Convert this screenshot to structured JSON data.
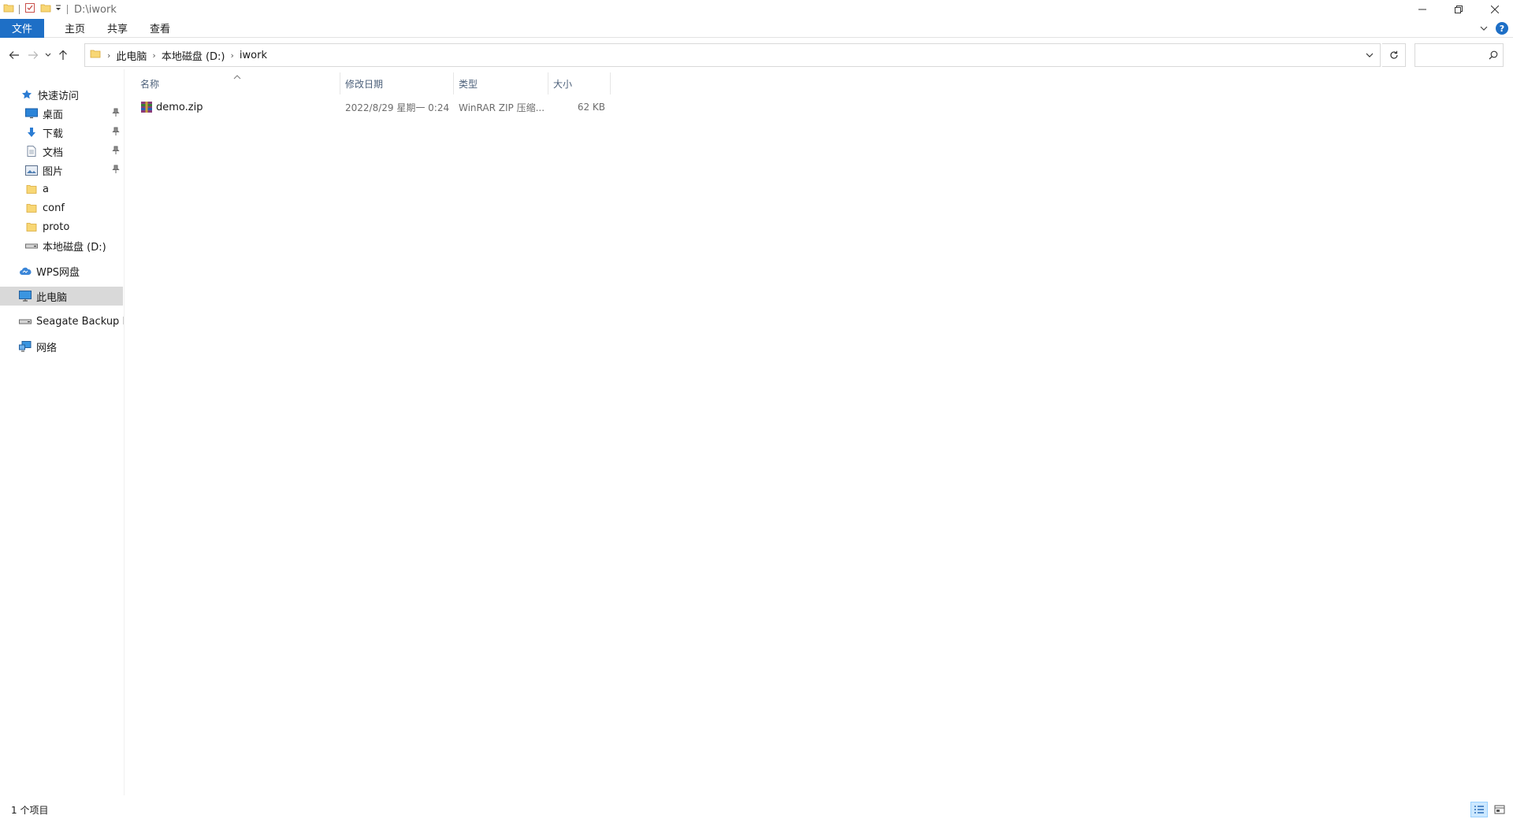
{
  "titlebar": {
    "title": "D:\\iwork",
    "quick_access_icons": [
      "folder-icon",
      "properties-check-icon",
      "new-folder-icon",
      "customize-dropdown-icon"
    ],
    "window_controls": [
      "minimize-icon",
      "restore-icon",
      "close-icon"
    ]
  },
  "ribbon": {
    "tabs": [
      {
        "label": "文件"
      },
      {
        "label": "主页"
      },
      {
        "label": "共享"
      },
      {
        "label": "查看"
      }
    ],
    "accent_color": "#1e6fc6"
  },
  "navbar": {
    "breadcrumbs": [
      {
        "label": "此电脑"
      },
      {
        "label": "本地磁盘 (D:)"
      },
      {
        "label": "iwork"
      }
    ],
    "search_placeholder": ""
  },
  "navpane": {
    "items": [
      {
        "label": "快速访问",
        "icon": "star-icon",
        "pinned": false
      },
      {
        "label": "桌面",
        "icon": "desktop-icon",
        "pinned": true
      },
      {
        "label": "下载",
        "icon": "download-icon",
        "pinned": true
      },
      {
        "label": "文档",
        "icon": "document-icon",
        "pinned": true
      },
      {
        "label": "图片",
        "icon": "pictures-icon",
        "pinned": true
      },
      {
        "label": "a",
        "icon": "folder-icon",
        "pinned": false
      },
      {
        "label": "conf",
        "icon": "folder-icon",
        "pinned": false
      },
      {
        "label": "proto",
        "icon": "folder-icon",
        "pinned": false
      },
      {
        "label": "本地磁盘 (D:)",
        "icon": "drive-icon",
        "pinned": false
      },
      {
        "label": "WPS网盘",
        "icon": "cloud-icon",
        "pinned": false
      },
      {
        "label": "此电脑",
        "icon": "computer-icon",
        "pinned": false,
        "selected": true
      },
      {
        "label": "Seagate Backup Plus Drive",
        "icon": "drive-icon",
        "pinned": false
      },
      {
        "label": "网络",
        "icon": "network-icon",
        "pinned": false
      }
    ]
  },
  "filelist": {
    "columns": [
      {
        "label": "名称"
      },
      {
        "label": "修改日期"
      },
      {
        "label": "类型"
      },
      {
        "label": "大小"
      }
    ],
    "sorted_by": "名称",
    "rows": [
      {
        "name": "demo.zip",
        "modified": "2022/8/29 星期一 0:24",
        "type": "WinRAR ZIP 压缩...",
        "size": "62 KB",
        "icon": "winrar-archive-icon"
      }
    ]
  },
  "status": {
    "item_count": "1 个项目",
    "view_modes": [
      "details-view-icon",
      "large-icons-view-icon"
    ],
    "active_view": "details-view-icon"
  }
}
